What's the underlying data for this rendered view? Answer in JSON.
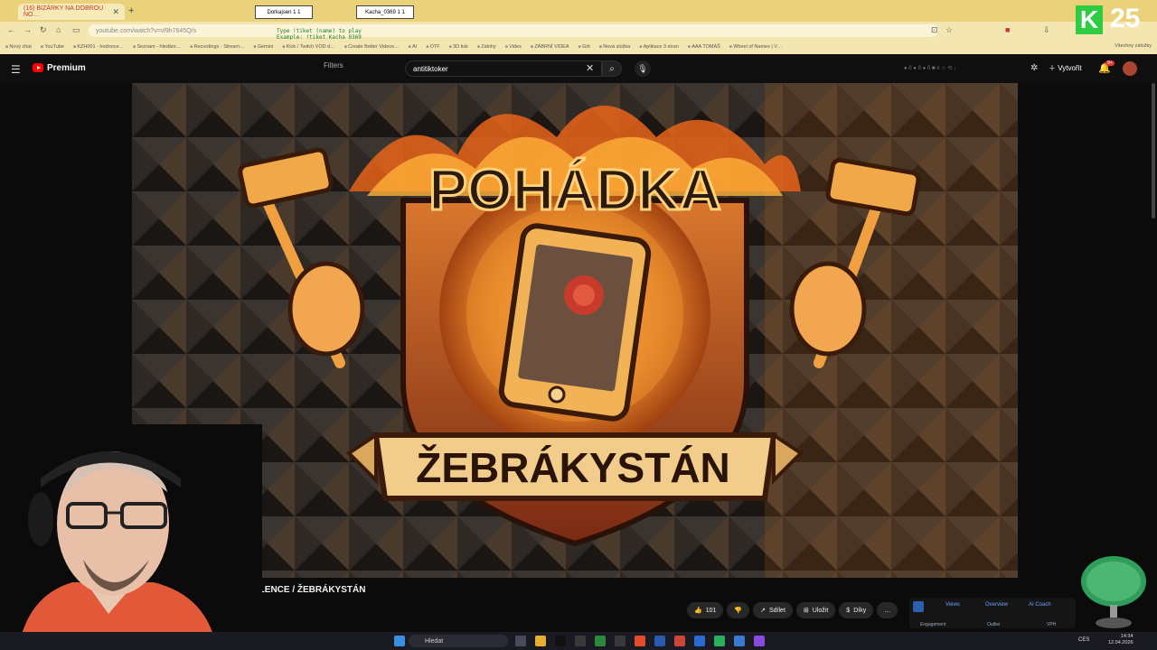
{
  "browser": {
    "tabs": [
      {
        "label": "(16) BIZÁRKY NA DOBROU NO…"
      },
      {
        "label": "Dorkajsen 1 1"
      },
      {
        "label": "Kacha_0369 1 1"
      }
    ],
    "new_tab": "+",
    "url": "youtube.com/watch?v=vl9h7645Q/s",
    "bookmarks": [
      "Nový chat",
      "YouTube",
      "KZH001 - hodnoce…",
      "Seznam - hledám…",
      "Recordings - Stream…",
      "Gemini",
      "Kick / Twitch VOD d…",
      "Create Better Videos…",
      "AI",
      "OTF",
      "3D tisk",
      "Zálohy",
      "Videx",
      "ZÁBRNÍ VIDEA",
      "Grit",
      "Nová složka",
      "Aplikace 3 stran",
      "AAA TOMÁŠ",
      "Wheel of Names | V…"
    ],
    "bookmarks_all": "Všechny záložky",
    "overlay_lines": [
      "Type !tiket (name) to play",
      "Example: !tiket Kacha_0369"
    ],
    "brand_letter": "K",
    "brand_number": "25"
  },
  "youtube": {
    "logo_label": "Premium",
    "filters_label": "Filters",
    "search_value": "antitiktoker",
    "create_label": "Vytvořit",
    "bell_badge": "9+",
    "icons": {
      "menu": "hamburger-icon",
      "search": "search-icon",
      "mic": "mic-icon",
      "clear": "close-icon",
      "bell": "bell-icon",
      "create": "plus-icon"
    }
  },
  "video": {
    "artwork_top_text": "POHÁDKA",
    "artwork_banner_text": "ŽEBRÁKYSTÁN",
    "title_visible": "NĚ LENCE / ŽEBRÁKYSTÁN",
    "like_count": "101",
    "share_label": "Sdílet",
    "save_label": "Uložit",
    "thanks_label": "Díky",
    "more_label": "…"
  },
  "analytics_panel": {
    "tabs": [
      "Views",
      "Overview",
      "AI Coach"
    ],
    "sub_labels": [
      "Engagement",
      "Outlier",
      "VPH"
    ]
  },
  "taskbar": {
    "search_placeholder": "Hledat",
    "lang": "CES",
    "time": "14:34",
    "date": "12.04.2026"
  },
  "colors": {
    "tabbar": "#e9d27a",
    "youtube_red": "#ff0000",
    "brand_green": "#2ecc40",
    "artwork_orange": "#f0a040"
  }
}
